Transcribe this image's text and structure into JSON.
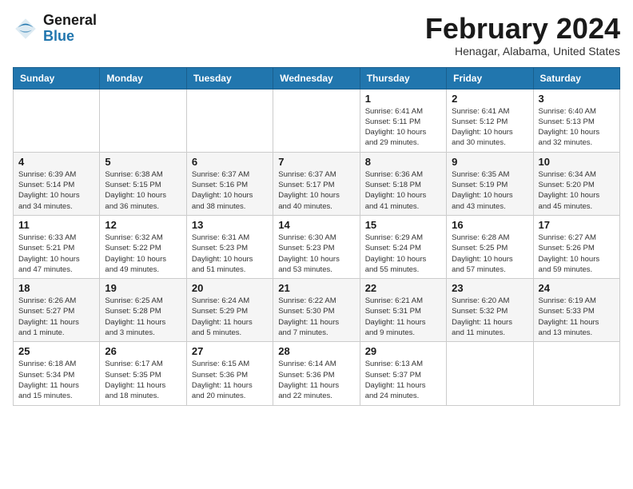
{
  "app": {
    "name_line1": "General",
    "name_line2": "Blue"
  },
  "header": {
    "month": "February 2024",
    "location": "Henagar, Alabama, United States"
  },
  "weekdays": [
    "Sunday",
    "Monday",
    "Tuesday",
    "Wednesday",
    "Thursday",
    "Friday",
    "Saturday"
  ],
  "weeks": [
    [
      {
        "day": "",
        "info": ""
      },
      {
        "day": "",
        "info": ""
      },
      {
        "day": "",
        "info": ""
      },
      {
        "day": "",
        "info": ""
      },
      {
        "day": "1",
        "info": "Sunrise: 6:41 AM\nSunset: 5:11 PM\nDaylight: 10 hours\nand 29 minutes."
      },
      {
        "day": "2",
        "info": "Sunrise: 6:41 AM\nSunset: 5:12 PM\nDaylight: 10 hours\nand 30 minutes."
      },
      {
        "day": "3",
        "info": "Sunrise: 6:40 AM\nSunset: 5:13 PM\nDaylight: 10 hours\nand 32 minutes."
      }
    ],
    [
      {
        "day": "4",
        "info": "Sunrise: 6:39 AM\nSunset: 5:14 PM\nDaylight: 10 hours\nand 34 minutes."
      },
      {
        "day": "5",
        "info": "Sunrise: 6:38 AM\nSunset: 5:15 PM\nDaylight: 10 hours\nand 36 minutes."
      },
      {
        "day": "6",
        "info": "Sunrise: 6:37 AM\nSunset: 5:16 PM\nDaylight: 10 hours\nand 38 minutes."
      },
      {
        "day": "7",
        "info": "Sunrise: 6:37 AM\nSunset: 5:17 PM\nDaylight: 10 hours\nand 40 minutes."
      },
      {
        "day": "8",
        "info": "Sunrise: 6:36 AM\nSunset: 5:18 PM\nDaylight: 10 hours\nand 41 minutes."
      },
      {
        "day": "9",
        "info": "Sunrise: 6:35 AM\nSunset: 5:19 PM\nDaylight: 10 hours\nand 43 minutes."
      },
      {
        "day": "10",
        "info": "Sunrise: 6:34 AM\nSunset: 5:20 PM\nDaylight: 10 hours\nand 45 minutes."
      }
    ],
    [
      {
        "day": "11",
        "info": "Sunrise: 6:33 AM\nSunset: 5:21 PM\nDaylight: 10 hours\nand 47 minutes."
      },
      {
        "day": "12",
        "info": "Sunrise: 6:32 AM\nSunset: 5:22 PM\nDaylight: 10 hours\nand 49 minutes."
      },
      {
        "day": "13",
        "info": "Sunrise: 6:31 AM\nSunset: 5:23 PM\nDaylight: 10 hours\nand 51 minutes."
      },
      {
        "day": "14",
        "info": "Sunrise: 6:30 AM\nSunset: 5:23 PM\nDaylight: 10 hours\nand 53 minutes."
      },
      {
        "day": "15",
        "info": "Sunrise: 6:29 AM\nSunset: 5:24 PM\nDaylight: 10 hours\nand 55 minutes."
      },
      {
        "day": "16",
        "info": "Sunrise: 6:28 AM\nSunset: 5:25 PM\nDaylight: 10 hours\nand 57 minutes."
      },
      {
        "day": "17",
        "info": "Sunrise: 6:27 AM\nSunset: 5:26 PM\nDaylight: 10 hours\nand 59 minutes."
      }
    ],
    [
      {
        "day": "18",
        "info": "Sunrise: 6:26 AM\nSunset: 5:27 PM\nDaylight: 11 hours\nand 1 minute."
      },
      {
        "day": "19",
        "info": "Sunrise: 6:25 AM\nSunset: 5:28 PM\nDaylight: 11 hours\nand 3 minutes."
      },
      {
        "day": "20",
        "info": "Sunrise: 6:24 AM\nSunset: 5:29 PM\nDaylight: 11 hours\nand 5 minutes."
      },
      {
        "day": "21",
        "info": "Sunrise: 6:22 AM\nSunset: 5:30 PM\nDaylight: 11 hours\nand 7 minutes."
      },
      {
        "day": "22",
        "info": "Sunrise: 6:21 AM\nSunset: 5:31 PM\nDaylight: 11 hours\nand 9 minutes."
      },
      {
        "day": "23",
        "info": "Sunrise: 6:20 AM\nSunset: 5:32 PM\nDaylight: 11 hours\nand 11 minutes."
      },
      {
        "day": "24",
        "info": "Sunrise: 6:19 AM\nSunset: 5:33 PM\nDaylight: 11 hours\nand 13 minutes."
      }
    ],
    [
      {
        "day": "25",
        "info": "Sunrise: 6:18 AM\nSunset: 5:34 PM\nDaylight: 11 hours\nand 15 minutes."
      },
      {
        "day": "26",
        "info": "Sunrise: 6:17 AM\nSunset: 5:35 PM\nDaylight: 11 hours\nand 18 minutes."
      },
      {
        "day": "27",
        "info": "Sunrise: 6:15 AM\nSunset: 5:36 PM\nDaylight: 11 hours\nand 20 minutes."
      },
      {
        "day": "28",
        "info": "Sunrise: 6:14 AM\nSunset: 5:36 PM\nDaylight: 11 hours\nand 22 minutes."
      },
      {
        "day": "29",
        "info": "Sunrise: 6:13 AM\nSunset: 5:37 PM\nDaylight: 11 hours\nand 24 minutes."
      },
      {
        "day": "",
        "info": ""
      },
      {
        "day": "",
        "info": ""
      }
    ]
  ]
}
